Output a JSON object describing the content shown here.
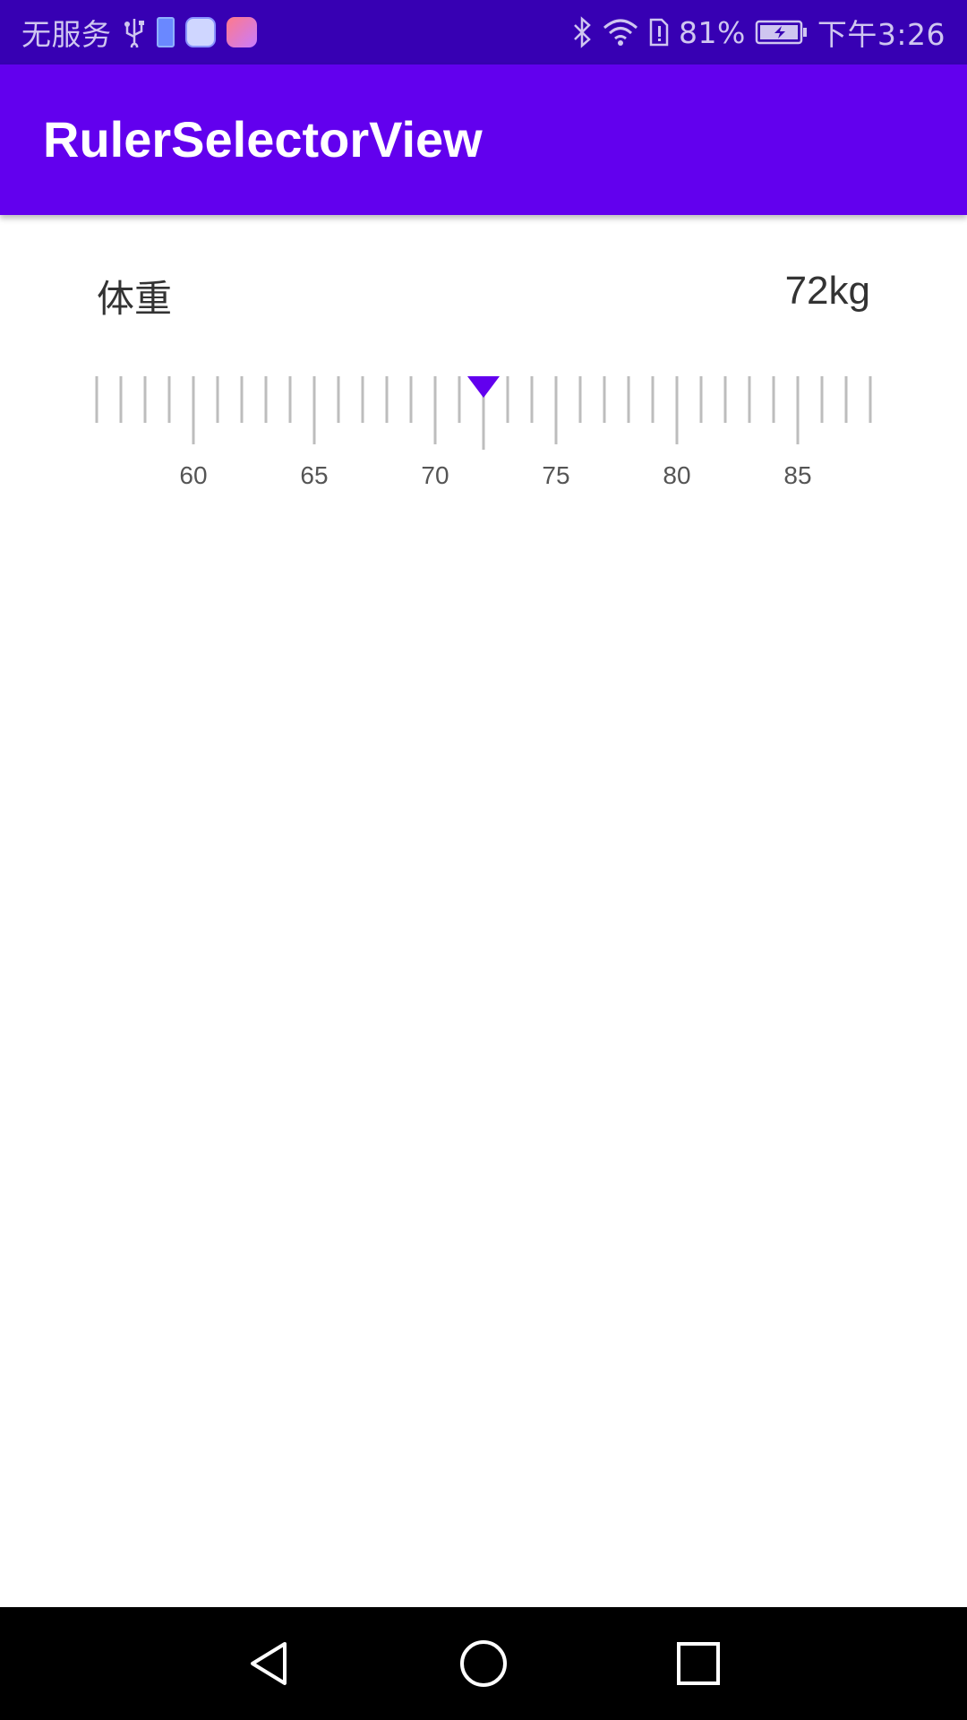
{
  "status_bar": {
    "carrier": "无服务",
    "battery_percent": "81%",
    "time": "下午3:26",
    "icons": [
      "usb-icon",
      "battery-charging-icon",
      "browser-app-icon",
      "paint-app-icon",
      "bluetooth-icon",
      "wifi-icon",
      "sim-alert-icon",
      "battery-icon"
    ]
  },
  "app_bar": {
    "title": "RulerSelectorView"
  },
  "weight": {
    "label": "体重",
    "value_text": "72kg"
  },
  "ruler": {
    "min": 56,
    "max": 88,
    "selected": 72,
    "major_step": 5,
    "tick_labels": [
      "60",
      "65",
      "70",
      "75",
      "80",
      "85"
    ],
    "indicator_color": "#6200ee",
    "tick_color": "#bdbdbd"
  },
  "nav_bar": {
    "buttons": [
      "back-icon",
      "home-icon",
      "recents-icon"
    ]
  },
  "colors": {
    "status_bar": "#3700b3",
    "app_bar": "#6200ee"
  }
}
